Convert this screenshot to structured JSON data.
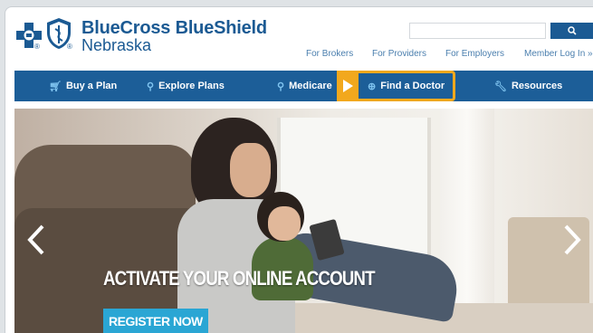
{
  "brand": {
    "line1": "BlueCross BlueShield",
    "line2": "Nebraska",
    "reg_mark": "®",
    "colors": {
      "primary": "#1b5a93",
      "accent": "#2aa6d4",
      "highlight": "#f2a81d"
    }
  },
  "search": {
    "placeholder": "",
    "button_icon": "search-icon"
  },
  "toplinks": [
    "For Brokers",
    "For Providers",
    "For Employers",
    "Member Log In »"
  ],
  "nav": {
    "items": [
      {
        "label": "Buy a Plan",
        "icon": "cart-icon"
      },
      {
        "label": "Explore Plans",
        "icon": "search-icon"
      },
      {
        "label": "Medicare",
        "icon": "search-icon"
      },
      {
        "label": "Find a Doctor",
        "icon": "location-icon"
      },
      {
        "label": "Resources",
        "icon": "wrench-icon"
      }
    ]
  },
  "hero": {
    "title": "ACTIVATE YOUR ONLINE ACCOUNT",
    "cta": "REGISTER NOW"
  }
}
